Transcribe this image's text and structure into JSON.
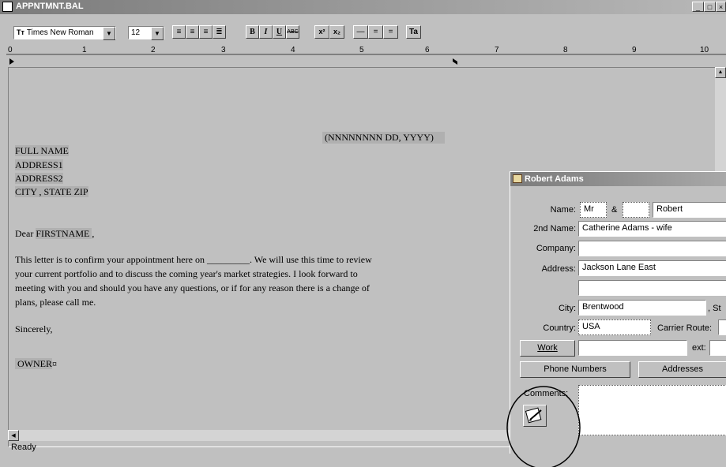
{
  "window": {
    "title": "APPNTMNT.BAL"
  },
  "toolbar": {
    "font_name": "Times New Roman",
    "font_size": "12",
    "bold": "B",
    "italic": "I",
    "underline": "U",
    "strike": "ABC",
    "superscript": "x²",
    "subscript": "x₂"
  },
  "ruler": {
    "marks": [
      "0",
      "1",
      "2",
      "3",
      "4",
      "5",
      "6",
      "7",
      "8",
      "9",
      "10"
    ]
  },
  "document": {
    "date_field": "(NNNNNNNN DD, YYYY)",
    "full_name": "FULL NAME",
    "address1": "ADDRESS1",
    "address2": "ADDRESS2",
    "city_state_zip": "CITY , STATE  ZIP",
    "salutation_prefix": "Dear ",
    "salutation_field": "FIRSTNAME ",
    "salutation_suffix": ",",
    "body_lines": [
      "This letter is to confirm your appointment here on _________.  We will use this time to review",
      "your current portfolio and to discuss the coming year's market strategies.  I look forward to",
      "meeting with you and should you have any questions, or if for any reason there is a change of",
      "plans, please call me."
    ],
    "closing": "Sincerely,",
    "owner_field": "OWNER",
    "owner_mark": "¤"
  },
  "status": {
    "text": "Ready"
  },
  "dialog": {
    "title": "Robert Adams",
    "name_label": "Name:",
    "salutation": "Mr",
    "and_label": "&",
    "spouse_salutation": "",
    "first_name": "Robert",
    "second_name_label": "2nd Name:",
    "second_name": "Catherine Adams - wife",
    "company_label": "Company:",
    "company": "",
    "address_label": "Address:",
    "address1": "Jackson Lane East",
    "address2": "",
    "city_label": "City:",
    "city": "Brentwood",
    "state_label": ", St",
    "country_label": "Country:",
    "country": "USA",
    "carrier_route_label": "Carrier Route:",
    "work_button": "Work",
    "work_phone": "",
    "ext_label": "ext:",
    "phone_numbers_button": "Phone Numbers",
    "addresses_button": "Addresses",
    "comments_label": "Comments:",
    "comments": ""
  }
}
